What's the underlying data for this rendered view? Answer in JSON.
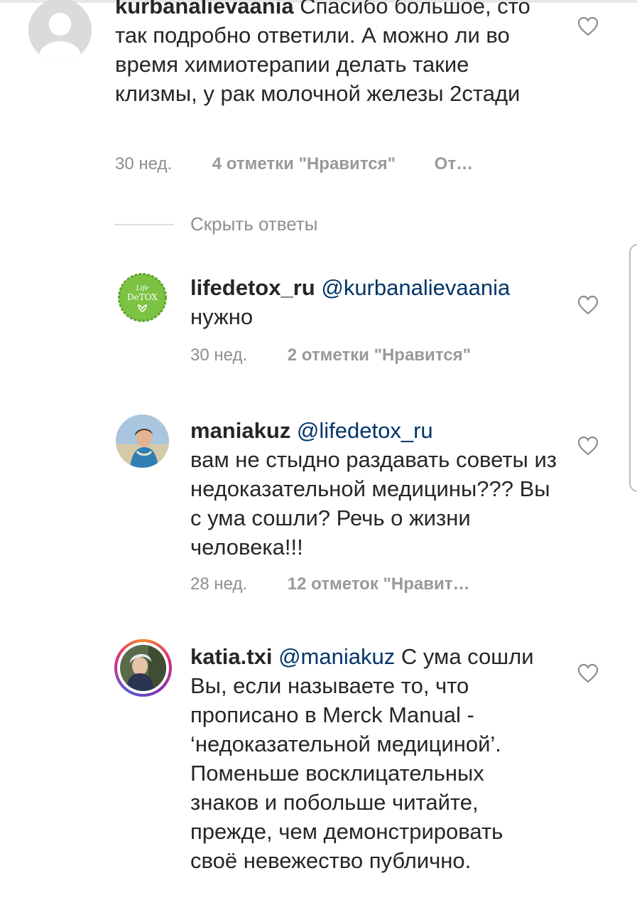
{
  "comments": [
    {
      "username": "kurbanalievaania",
      "body": "Спасибо большое, сто так подробно ответили.  А можно ли во  время химиотерапии делать такие клизмы,  у рак молочной железы 2стади",
      "time": "30 нед.",
      "likes": "4 отметки \"Нравится\"",
      "reply": "От…"
    },
    {
      "username": "lifedetox_ru",
      "mention": "@kurbanalievaania",
      "body": "нужно",
      "time": "30 нед.",
      "likes": "2 отметки \"Нравится\"",
      "avatar_text_top": "Life",
      "avatar_text_bottom": "DeTOX"
    },
    {
      "username": "maniakuz",
      "mention": "@lifedetox_ru",
      "body": "вам не стыдно раздавать советы из недоказательной медицины??? Вы с ума сошли? Речь о жизни человека!!!",
      "time": "28 нед.",
      "likes": "12 отметок \"Нравит…"
    },
    {
      "username": "katia.txi",
      "mention": "@maniakuz",
      "body": "С ума сошли Вы, если называете то, что прописано в Merck Manual - ‘недоказательной медициной’. Поменьше восклицательных знаков и побольше читайте, прежде, чем демонстрировать своё невежество публично."
    }
  ],
  "hide_replies": "Скрыть ответы",
  "icons": {
    "like": "heart-outline-icon"
  },
  "colors": {
    "text": "#262626",
    "muted": "#8e8e8e",
    "mention": "#003569",
    "detox_green": "#6cc04a"
  }
}
